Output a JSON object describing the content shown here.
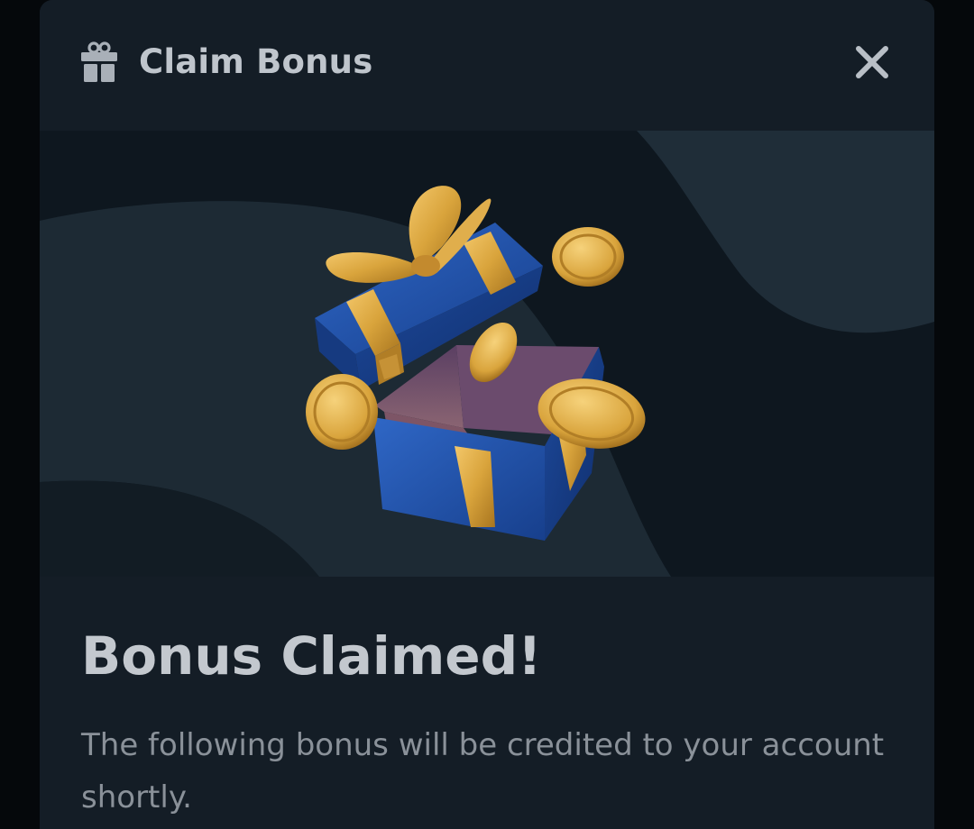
{
  "modal": {
    "title": "Claim Bonus",
    "title_icon": "gift-icon",
    "close_icon": "close-icon"
  },
  "banner": {
    "illustration": "open-gift-box-with-coins"
  },
  "content": {
    "headline": "Bonus Claimed!",
    "description": "The following bonus will be credited to your account shortly."
  },
  "colors": {
    "backdrop": "#05080b",
    "modal_bg": "#141d26",
    "banner_bg": "#0e171f",
    "title_text": "#bfc5cc",
    "body_text": "#8a9199",
    "gift_blue": "#1f4fa8",
    "ribbon_gold": "#d9a43c"
  }
}
